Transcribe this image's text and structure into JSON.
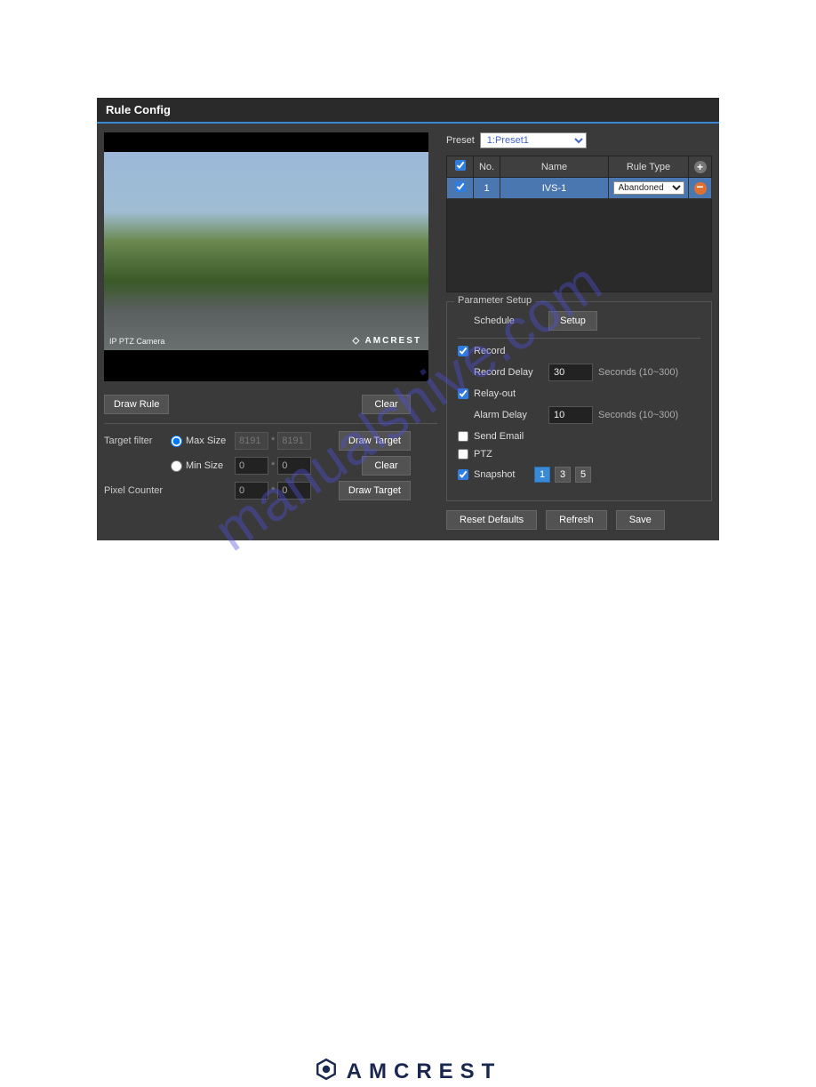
{
  "header": {
    "title": "Rule Config"
  },
  "video": {
    "camera_label": "IP PTZ Camera",
    "brand_overlay": "◇ AMCREST"
  },
  "left": {
    "draw_rule": "Draw Rule",
    "clear": "Clear",
    "target_filter": "Target filter",
    "max_size": "Max Size",
    "min_size": "Min Size",
    "pixel_counter": "Pixel Counter",
    "max_w": "8191",
    "max_h": "8191",
    "min_w": "0",
    "min_h": "0",
    "pix_w": "0",
    "pix_h": "0",
    "draw_target": "Draw Target"
  },
  "preset": {
    "label": "Preset",
    "selected": "1:Preset1"
  },
  "rules_table": {
    "headers": {
      "no": "No.",
      "name": "Name",
      "type": "Rule Type"
    },
    "row": {
      "no": "1",
      "name": "IVS-1",
      "type": "Abandoned"
    }
  },
  "param": {
    "legend": "Parameter Setup",
    "schedule": "Schedule",
    "setup": "Setup",
    "record": "Record",
    "record_delay": "Record Delay",
    "record_delay_val": "30",
    "seconds_hint": "Seconds (10~300)",
    "relay_out": "Relay-out",
    "alarm_delay": "Alarm Delay",
    "alarm_delay_val": "10",
    "send_email": "Send Email",
    "ptz": "PTZ",
    "snapshot": "Snapshot",
    "snap": [
      "1",
      "3",
      "5"
    ]
  },
  "bottom": {
    "reset": "Reset Defaults",
    "refresh": "Refresh",
    "save": "Save"
  },
  "watermark": "manualshive.com",
  "footer_brand": "AMCREST"
}
